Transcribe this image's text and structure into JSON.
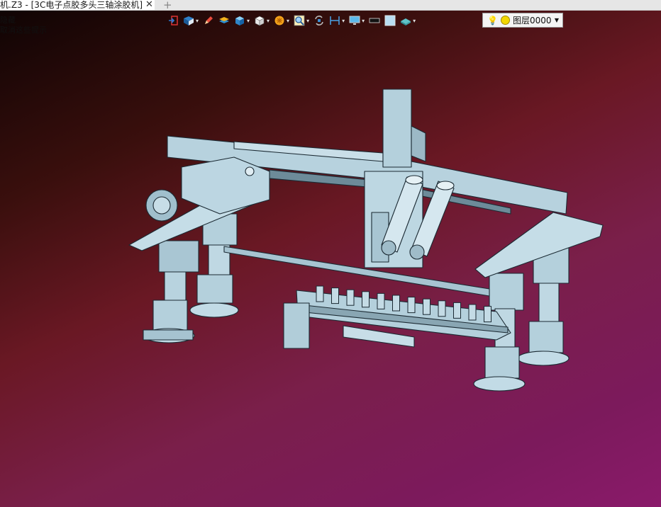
{
  "tab": {
    "title": "机.Z3 - [3C电子点胶多头三轴涂胶机]",
    "close": "✕",
    "new_tab": "+"
  },
  "info_lines": [
    "隐藏",
    "取消这些提示"
  ],
  "toolbar": {
    "items": [
      {
        "icon": "exit-icon",
        "dropdown": false
      },
      {
        "icon": "view-display-icon",
        "dropdown": true
      },
      {
        "icon": "pencil-icon",
        "dropdown": false
      },
      {
        "icon": "layer-stack-icon",
        "dropdown": false
      },
      {
        "icon": "shaded-cube-icon",
        "dropdown": true
      },
      {
        "icon": "wire-cube-icon",
        "dropdown": true
      },
      {
        "icon": "render-settings-icon",
        "dropdown": true
      },
      {
        "icon": "zoom-view-icon",
        "dropdown": true
      },
      {
        "icon": "rotate-view-icon",
        "dropdown": false
      },
      {
        "icon": "dimension-icon",
        "dropdown": true
      },
      {
        "icon": "monitor-icon",
        "dropdown": true
      },
      {
        "icon": "line-color-icon",
        "dropdown": false
      },
      {
        "icon": "face-color-icon",
        "dropdown": false
      },
      {
        "icon": "material-icon",
        "dropdown": true
      }
    ],
    "layer_select": {
      "value": "图层0000"
    }
  },
  "colors": {
    "model_fill": "#b4d0dc",
    "model_edge": "#1b2a33"
  }
}
